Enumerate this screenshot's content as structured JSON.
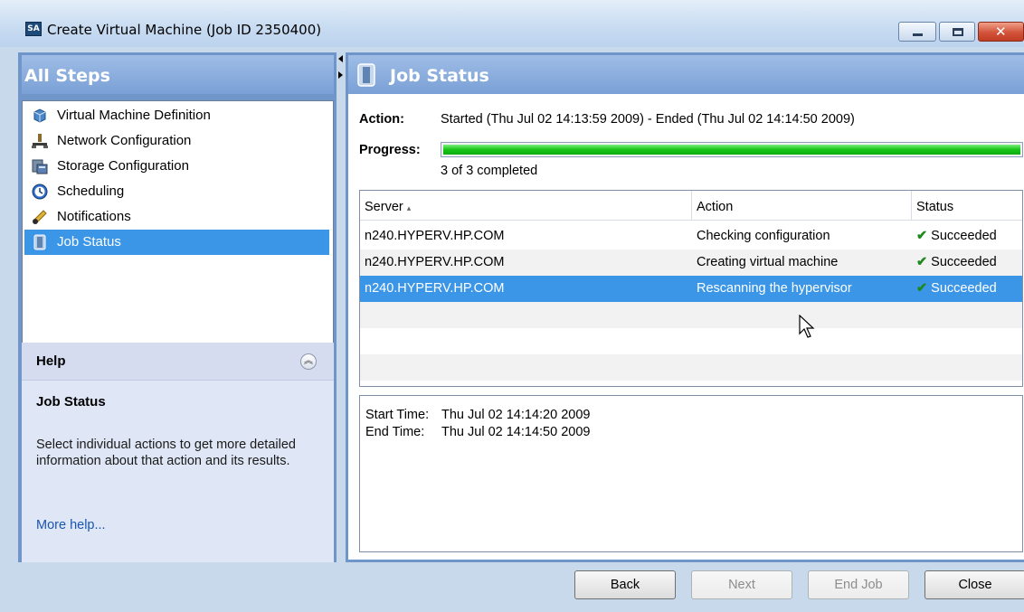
{
  "window": {
    "title": "Create Virtual Machine (Job ID 2350400)",
    "app_icon_text": "SA"
  },
  "sidebar": {
    "header": "All Steps",
    "items": [
      {
        "label": "Virtual Machine Definition",
        "icon": "virtual-machine-icon"
      },
      {
        "label": "Network Configuration",
        "icon": "network-icon"
      },
      {
        "label": "Storage Configuration",
        "icon": "storage-icon"
      },
      {
        "label": "Scheduling",
        "icon": "clock-icon"
      },
      {
        "label": "Notifications",
        "icon": "notifications-icon"
      },
      {
        "label": "Job Status",
        "icon": "job-status-icon",
        "selected": true
      }
    ]
  },
  "help": {
    "title": "Help",
    "subtitle": "Job Status",
    "body": "Select individual actions to get more detailed information about that action and its results.",
    "link": "More help..."
  },
  "main": {
    "title": "Job Status",
    "action_label": "Action:",
    "action_value": "Started (Thu Jul 02 14:13:59 2009) - Ended (Thu Jul 02 14:14:50 2009)",
    "progress_label": "Progress:",
    "progress_fraction": 1.0,
    "progress_text": "3 of 3 completed",
    "table": {
      "columns": [
        "Server",
        "Action",
        "Status"
      ],
      "rows": [
        {
          "server": "n240.HYPERV.HP.COM",
          "action": "Checking configuration",
          "status": "Succeeded"
        },
        {
          "server": "n240.HYPERV.HP.COM",
          "action": "Creating virtual machine",
          "status": "Succeeded"
        },
        {
          "server": "n240.HYPERV.HP.COM",
          "action": "Rescanning the hypervisor",
          "status": "Succeeded",
          "selected": true
        }
      ]
    },
    "details": {
      "start_label": "Start Time:",
      "start_value": "Thu Jul 02 14:14:20 2009",
      "end_label": "End Time:",
      "end_value": "Thu Jul 02 14:14:50 2009"
    }
  },
  "footer": {
    "back": "Back",
    "next": "Next",
    "end_job": "End Job",
    "close": "Close"
  },
  "colors": {
    "selection": "#3b96e8",
    "header_gradient": "#7aa0d6",
    "progress_fill": "#17c417",
    "success_check": "#1e8a1e"
  }
}
